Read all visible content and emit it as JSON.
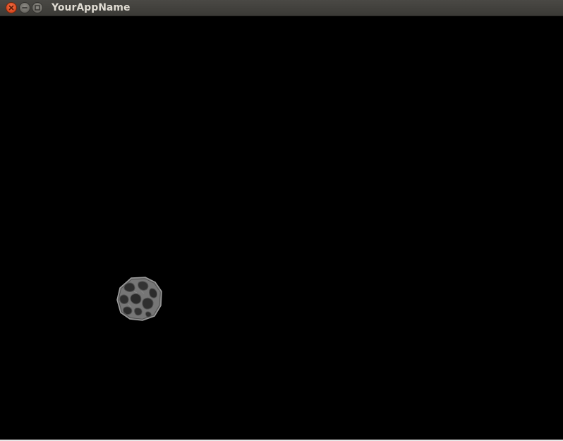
{
  "window": {
    "title": "YourAppName",
    "controls": {
      "close_icon": "close-icon",
      "minimize_icon": "minimize-icon",
      "maximize_icon": "maximize-icon"
    }
  },
  "scene": {
    "background_color": "#000000",
    "objects": [
      {
        "type": "asteroid",
        "color": "#6e6e6e"
      }
    ]
  },
  "colors": {
    "titlebar": "#3c3b37",
    "close_button": "#e4532a",
    "title_text": "#dfdbd2"
  }
}
